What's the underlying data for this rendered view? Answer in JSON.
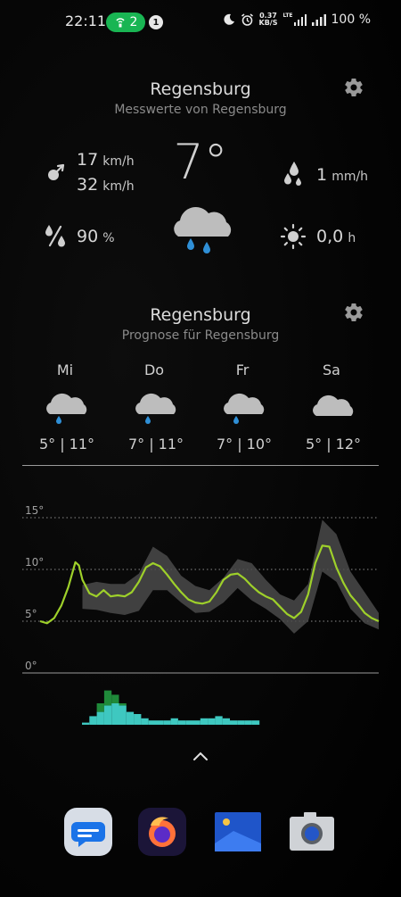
{
  "status_bar": {
    "time": "22:11",
    "hotspot_count": "2",
    "notification_count": "1",
    "net_speed_value": "0.37",
    "net_speed_unit": "KB/S",
    "network_type": "LTE",
    "battery": "100 %"
  },
  "current_widget": {
    "city": "Regensburg",
    "subtitle": "Messwerte von Regensburg",
    "temperature": "7°",
    "wind_speed": "17",
    "wind_gust": "32",
    "wind_unit": "km/h",
    "humidity": "90",
    "humidity_unit": "%",
    "precipitation": "1",
    "precipitation_unit": "mm/h",
    "sunshine": "0,0",
    "sunshine_unit": "h",
    "condition_icon": "cloud-rain-icon"
  },
  "forecast_widget": {
    "city": "Regensburg",
    "subtitle": "Prognose für Regensburg",
    "days": [
      {
        "day": "Mi",
        "range": "5° | 11°",
        "icon": "cloud-rain-icon"
      },
      {
        "day": "Do",
        "range": "7° | 11°",
        "icon": "cloud-rain-icon"
      },
      {
        "day": "Fr",
        "range": "7° | 10°",
        "icon": "cloud-rain-icon"
      },
      {
        "day": "Sa",
        "range": "5° | 12°",
        "icon": "cloud-icon"
      }
    ]
  },
  "chart_data": {
    "type": "line",
    "y_ticks": [
      "15°",
      "10°",
      "5°",
      "0°"
    ],
    "ylim": [
      0,
      15
    ],
    "series": [
      {
        "color": "#9ed02a",
        "x": [
          0,
          2,
          4,
          6,
          8,
          10,
          11,
          12,
          14,
          16,
          18,
          20,
          22,
          24,
          26,
          28,
          30,
          32,
          34,
          36,
          38,
          40,
          42,
          44,
          46,
          48,
          50,
          52,
          54,
          56,
          58,
          60,
          62,
          64,
          66,
          68,
          70,
          72,
          74,
          76,
          78,
          80,
          82,
          84,
          86,
          88,
          90,
          92,
          94,
          96
        ],
        "values": [
          5.0,
          4.8,
          5.3,
          6.5,
          8.3,
          10.7,
          10.4,
          9.0,
          7.7,
          7.4,
          8.0,
          7.4,
          7.5,
          7.4,
          7.8,
          8.8,
          10.2,
          10.6,
          10.3,
          9.5,
          8.6,
          7.8,
          7.1,
          6.8,
          6.7,
          6.9,
          7.8,
          9.0,
          9.5,
          9.6,
          9.1,
          8.4,
          7.8,
          7.4,
          7.1,
          6.4,
          5.7,
          5.3,
          5.9,
          7.6,
          10.6,
          12.3,
          12.2,
          10.2,
          8.7,
          7.5,
          6.7,
          5.8,
          5.3,
          5.0
        ]
      },
      {
        "color": "#3ec8c0",
        "values": [
          0.2,
          0.8,
          1.2,
          1.8,
          2.0,
          1.8,
          1.2,
          1.0,
          0.6,
          0.4,
          0.4,
          0.4,
          0.6,
          0.4,
          0.4,
          0.4,
          0.6,
          0.6,
          0.8,
          0.6,
          0.4,
          0.4,
          0.4,
          0.4
        ]
      },
      {
        "color": "#1f8a3a",
        "values": [
          0.0,
          0.0,
          0.8,
          1.4,
          0.8,
          0.2,
          0.0,
          0.0,
          0.0,
          0.0,
          0.0,
          0.0,
          0.0,
          0.0,
          0.0,
          0.0,
          0.0,
          0.0,
          0.0,
          0.0,
          0.0,
          0.0,
          0.0,
          0.0
        ]
      }
    ],
    "uncertainty_band": {
      "color": "#4a4a4a",
      "x": [
        12,
        16,
        20,
        24,
        28,
        32,
        36,
        40,
        44,
        48,
        52,
        56,
        60,
        64,
        68,
        72,
        76,
        80,
        84,
        88,
        92,
        96
      ],
      "low": [
        6.2,
        6.1,
        5.8,
        5.6,
        6.0,
        8.0,
        8.0,
        6.8,
        5.8,
        5.9,
        6.8,
        8.2,
        7.0,
        6.2,
        5.2,
        3.8,
        5.0,
        9.8,
        8.8,
        6.2,
        4.8,
        4.2
      ],
      "high": [
        8.5,
        8.8,
        8.6,
        8.6,
        9.6,
        12.2,
        11.3,
        9.4,
        8.4,
        8.0,
        9.2,
        11.0,
        10.6,
        9.0,
        7.6,
        7.0,
        8.6,
        14.8,
        13.4,
        9.8,
        7.8,
        5.8
      ]
    }
  }
}
